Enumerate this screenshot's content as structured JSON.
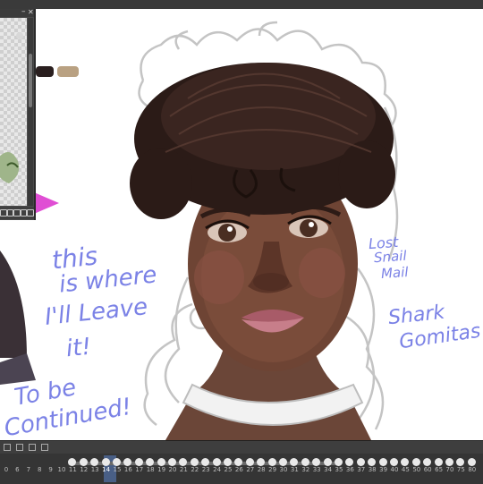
{
  "navigator": {
    "minimize_glyph": "–",
    "close_glyph": "✕"
  },
  "swatches": {
    "colors": [
      "#2a1f1f",
      "#b9a182"
    ]
  },
  "accent": {
    "pink_flag": "#e04ed4",
    "handwriting": "#7b82e6",
    "frame_cursor": "#5a82c8"
  },
  "note": {
    "line1": "this",
    "line2": "is where",
    "line3": "I'll Leave",
    "line4": "it!",
    "line5": "To be",
    "line6": "Continued!"
  },
  "credits": {
    "line1": "Lost",
    "line2": "Snail",
    "line3": "Mail",
    "line4": "Shark",
    "line5": "Gomitas"
  },
  "timeline": {
    "frames": [
      "0",
      "6",
      "7",
      "8",
      "9",
      "10",
      "11",
      "12",
      "13",
      "14",
      "15",
      "16",
      "17",
      "18",
      "19",
      "20",
      "21",
      "22",
      "23",
      "24",
      "25",
      "26",
      "27",
      "28",
      "29",
      "30",
      "31",
      "32",
      "33",
      "34",
      "35",
      "36",
      "37",
      "38",
      "39",
      "40",
      "45",
      "50",
      "60",
      "65",
      "70",
      "75",
      "80"
    ],
    "current_frame": "14"
  },
  "icons": [
    "minimize-icon",
    "close-icon",
    "rotate-icon",
    "flip-icon",
    "zoom-icon",
    "folder-icon",
    "trash-icon",
    "play-icon",
    "stop-icon",
    "onion-icon"
  ]
}
